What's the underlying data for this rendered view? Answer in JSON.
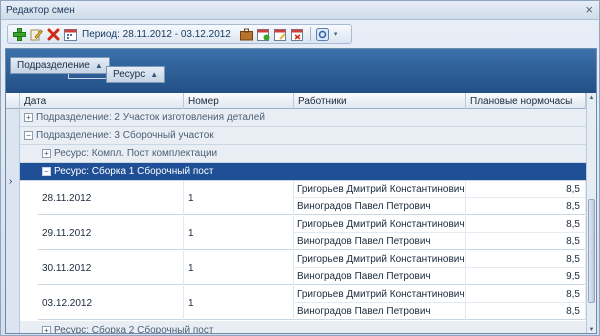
{
  "window": {
    "title": "Редактор смен",
    "close_icon": "×"
  },
  "toolbar": {
    "period_label": "Период: 28.11.2012 - 03.12.2012",
    "buttons": [
      "add-icon",
      "edit-icon",
      "delete-icon",
      "calendar-icon",
      "briefcase-icon",
      "calendar-add-icon",
      "calendar-edit-icon",
      "calendar-delete-icon",
      "settings-icon"
    ],
    "dropdown_icon": "▾"
  },
  "group_panel": {
    "chips": [
      {
        "label": "Подразделение",
        "arrow": "▲"
      },
      {
        "label": "Ресурс",
        "arrow": "▲"
      }
    ]
  },
  "columns": [
    "Дата",
    "Номер",
    "Работники",
    "Плановые нормочасы"
  ],
  "row_indicator": "›",
  "groups": [
    {
      "level": 0,
      "sign": "+",
      "label": "Подразделение: 2 Участок изготовления деталей",
      "selected": false
    },
    {
      "level": 0,
      "sign": "−",
      "label": "Подразделение: 3 Сборочный участок",
      "selected": false
    },
    {
      "level": 1,
      "sign": "+",
      "label": "Ресурс: Компл. Пост комплектации",
      "selected": false
    },
    {
      "level": 1,
      "sign": "−",
      "label": "Ресурс: Сборка 1 Сборочный пост",
      "selected": true
    }
  ],
  "rows": [
    {
      "date": "28.11.2012",
      "number": "1",
      "workers": [
        {
          "name": "Григорьев Дмитрий Константинович",
          "hours": "8,5"
        },
        {
          "name": "Виноградов Павел Петрович",
          "hours": "8,5"
        }
      ]
    },
    {
      "date": "29.11.2012",
      "number": "1",
      "workers": [
        {
          "name": "Григорьев Дмитрий Константинович",
          "hours": "8,5"
        },
        {
          "name": "Виноградов Павел Петрович",
          "hours": "8,5"
        }
      ]
    },
    {
      "date": "30.11.2012",
      "number": "1",
      "workers": [
        {
          "name": "Григорьев Дмитрий Константинович",
          "hours": "8,5"
        },
        {
          "name": "Виноградов Павел Петрович",
          "hours": "9,5"
        }
      ]
    },
    {
      "date": "03.12.2012",
      "number": "1",
      "workers": [
        {
          "name": "Григорьев Дмитрий Константинович",
          "hours": "8,5"
        },
        {
          "name": "Виноградов Павел Петрович",
          "hours": "8,5"
        }
      ]
    }
  ],
  "trailing_group": {
    "sign": "+",
    "label": "Ресурс: Сборка 2 Сборочный пост"
  },
  "scrollbar": {
    "up_icon": "▲",
    "down_icon": "▼"
  }
}
